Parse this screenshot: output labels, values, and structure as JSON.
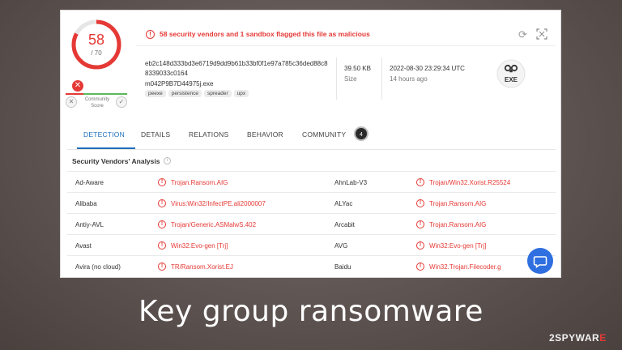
{
  "score": {
    "detections": "58",
    "total": "/ 70",
    "detection_fraction": 0.8286
  },
  "community": {
    "label": "Community Score"
  },
  "alert": {
    "text": "58 security vendors and 1 sandbox flagged this file as malicious"
  },
  "file": {
    "hash": "eb2c148d333bd3e6719d9dd9b61b33bf0f1e97a785c36ded88c88339033c0164",
    "name": "m042P9B7D44975j.exe",
    "tags": [
      "peexe",
      "persistence",
      "spreader",
      "upx"
    ],
    "size_value": "39.50 KB",
    "size_label": "Size",
    "date_value": "2022-08-30 23:29:34 UTC",
    "date_label": "14 hours ago",
    "type_label": "EXE"
  },
  "tabs": [
    {
      "label": "DETECTION"
    },
    {
      "label": "DETAILS"
    },
    {
      "label": "RELATIONS"
    },
    {
      "label": "BEHAVIOR"
    },
    {
      "label": "COMMUNITY",
      "badge": "4"
    }
  ],
  "section": {
    "title": "Security Vendors' Analysis"
  },
  "vendors": [
    {
      "left_name": "Ad-Aware",
      "left_result": "Trojan.Ransom.AIG",
      "right_name": "AhnLab-V3",
      "right_result": "Trojan/Win32.Xorist.R25524"
    },
    {
      "left_name": "Alibaba",
      "left_result": "Virus:Win32/InfectPE.ali2000007",
      "right_name": "ALYac",
      "right_result": "Trojan.Ransom.AIG"
    },
    {
      "left_name": "Antiy-AVL",
      "left_result": "Trojan/Generic.ASMalwS.402",
      "right_name": "Arcabit",
      "right_result": "Trojan.Ransom.AIG"
    },
    {
      "left_name": "Avast",
      "left_result": "Win32:Evo-gen [Trj]",
      "right_name": "AVG",
      "right_result": "Win32:Evo-gen [Trj]"
    },
    {
      "left_name": "Avira (no cloud)",
      "left_result": "TR/Ransom.Xorist.EJ",
      "right_name": "Baidu",
      "right_result": "Win32.Trojan.Filecoder.g"
    }
  ],
  "caption": {
    "text": "Key group ransomware"
  },
  "logo": {
    "part1": "2SPYWAR",
    "part2": "E"
  },
  "colors": {
    "malicious": "#e53935",
    "accent": "#1d6fbf",
    "chat": "#2f6fe0"
  }
}
